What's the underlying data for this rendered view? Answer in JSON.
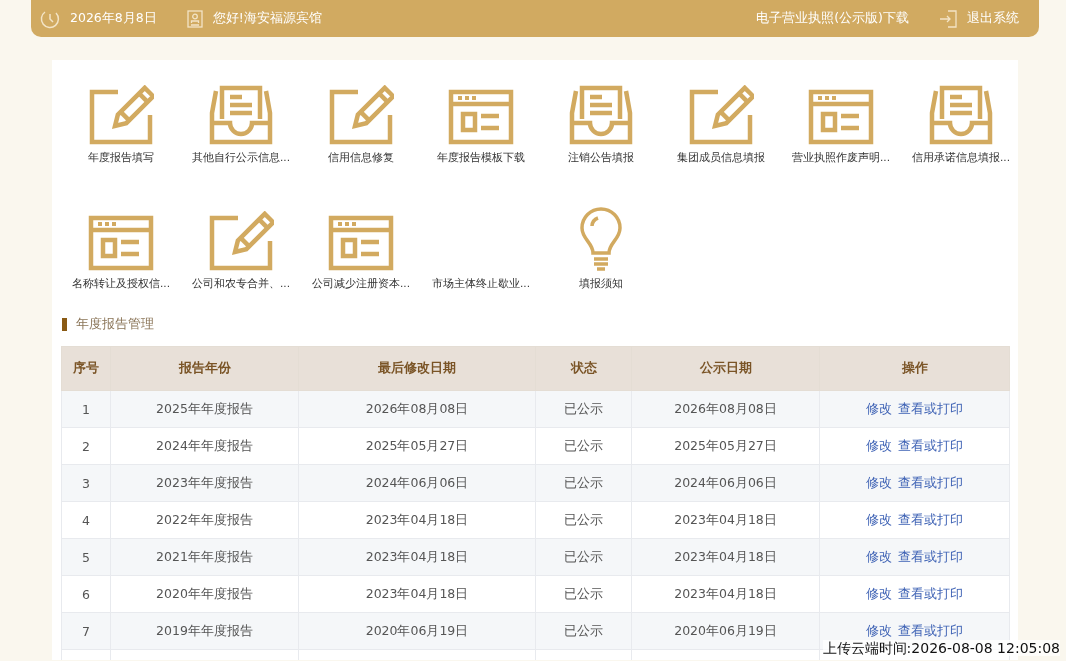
{
  "top_bar": {
    "date": "2026年8月8日",
    "greeting": "您好!海安福源宾馆",
    "license_download": "电子营业执照(公示版)下载",
    "logout": "退出系统"
  },
  "shortcuts": [
    {
      "label": "年度报告填写",
      "kind": "edit"
    },
    {
      "label": "其他自行公示信息...",
      "kind": "tray"
    },
    {
      "label": "信用信息修复",
      "kind": "edit"
    },
    {
      "label": "年度报告模板下载",
      "kind": "form"
    },
    {
      "label": "注销公告填报",
      "kind": "tray"
    },
    {
      "label": "集团成员信息填报",
      "kind": "edit"
    },
    {
      "label": "营业执照作废声明...",
      "kind": "form"
    },
    {
      "label": "信用承诺信息填报...",
      "kind": "tray"
    },
    {
      "label": "名称转让及授权信...",
      "kind": "form"
    },
    {
      "label": "公司和农专合并、...",
      "kind": "edit"
    },
    {
      "label": "公司减少注册资本...",
      "kind": "form"
    },
    {
      "label": "市场主体终止歇业...",
      "kind": "none"
    },
    {
      "label": "填报须知",
      "kind": "bulb"
    }
  ],
  "section_title": "年度报告管理",
  "table": {
    "columns": [
      "序号",
      "报告年份",
      "最后修改日期",
      "状态",
      "公示日期",
      "操作"
    ],
    "rows": [
      {
        "no": "1",
        "year": "2025年年度报告",
        "modified": "2026年08月08日",
        "status": "已公示",
        "published": "2026年08月08日",
        "actions": [
          "修改",
          "查看或打印"
        ]
      },
      {
        "no": "2",
        "year": "2024年年度报告",
        "modified": "2025年05月27日",
        "status": "已公示",
        "published": "2025年05月27日",
        "actions": [
          "修改",
          "查看或打印"
        ]
      },
      {
        "no": "3",
        "year": "2023年年度报告",
        "modified": "2024年06月06日",
        "status": "已公示",
        "published": "2024年06月06日",
        "actions": [
          "修改",
          "查看或打印"
        ]
      },
      {
        "no": "4",
        "year": "2022年年度报告",
        "modified": "2023年04月18日",
        "status": "已公示",
        "published": "2023年04月18日",
        "actions": [
          "修改",
          "查看或打印"
        ]
      },
      {
        "no": "5",
        "year": "2021年年度报告",
        "modified": "2023年04月18日",
        "status": "已公示",
        "published": "2023年04月18日",
        "actions": [
          "修改",
          "查看或打印"
        ]
      },
      {
        "no": "6",
        "year": "2020年年度报告",
        "modified": "2023年04月18日",
        "status": "已公示",
        "published": "2023年04月18日",
        "actions": [
          "修改",
          "查看或打印"
        ]
      },
      {
        "no": "7",
        "year": "2019年年度报告",
        "modified": "2020年06月19日",
        "status": "已公示",
        "published": "2020年06月19日",
        "actions": [
          "修改",
          "查看或打印"
        ]
      }
    ]
  },
  "upload_time": "上传云端时间:2026-08-08 12:05:08"
}
